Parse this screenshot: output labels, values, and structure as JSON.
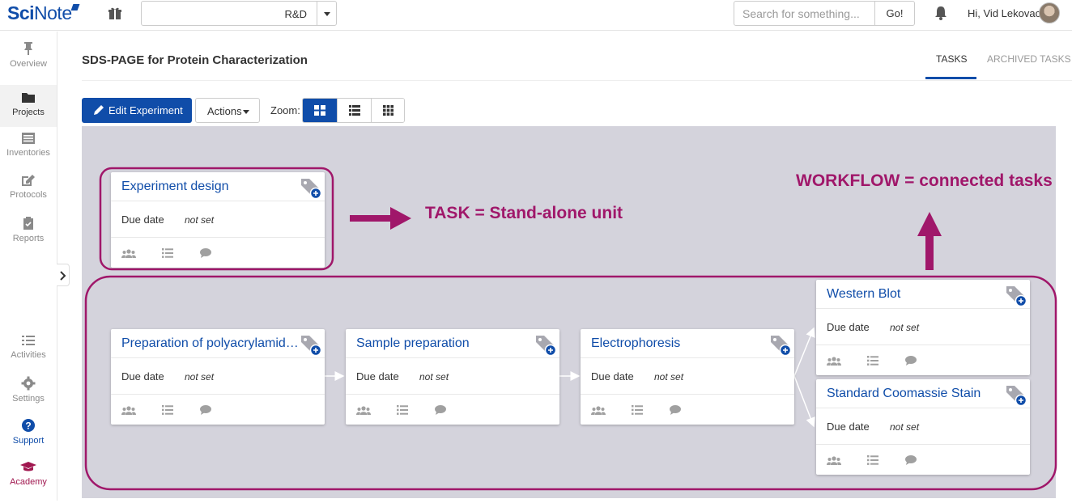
{
  "app": {
    "logo_bold": "Sci",
    "logo_rest": "Note"
  },
  "topbar": {
    "project_value": "R&D",
    "search_placeholder": "Search for something...",
    "go_label": "Go!",
    "greeting": "Hi, Vid Lekovac"
  },
  "sidebar": {
    "items": [
      {
        "label": "Overview",
        "icon": "pin-icon",
        "active": false
      },
      {
        "label": "Projects",
        "icon": "folder-icon",
        "active": true
      },
      {
        "label": "Inventories",
        "icon": "inventory-list-icon",
        "active": false
      },
      {
        "label": "Protocols",
        "icon": "edit-icon",
        "active": false
      },
      {
        "label": "Reports",
        "icon": "clipboard-icon",
        "active": false
      },
      {
        "label": "Activities",
        "icon": "list-icon",
        "active": false
      },
      {
        "label": "Settings",
        "icon": "gear-icon",
        "active": false
      },
      {
        "label": "Support",
        "icon": "question-icon",
        "active": false
      },
      {
        "label": "Academy",
        "icon": "graduation-cap-icon",
        "active": false
      }
    ]
  },
  "header": {
    "title": "SDS-PAGE for Protein Characterization",
    "tabs": [
      {
        "label": "TASKS",
        "active": true
      },
      {
        "label": "ARCHIVED TASKS",
        "active": false
      }
    ]
  },
  "toolbar": {
    "edit_label": "Edit Experiment",
    "actions_label": "Actions",
    "zoom_label": "Zoom:",
    "zoom_options": [
      "cards-view",
      "list-view",
      "grid-view"
    ],
    "zoom_active": "cards-view"
  },
  "tasks": [
    {
      "name": "Experiment design",
      "due_label": "Due date",
      "due_value": "not set"
    },
    {
      "name": "Preparation of polyacrylamide gel",
      "name_visible": "Preparation of polyacrylamid…",
      "due_label": "Due date",
      "due_value": "not set"
    },
    {
      "name": "Sample preparation",
      "due_label": "Due date",
      "due_value": "not set"
    },
    {
      "name": "Electrophoresis",
      "due_label": "Due date",
      "due_value": "not set"
    },
    {
      "name": "Western Blot",
      "due_label": "Due date",
      "due_value": "not set"
    },
    {
      "name": "Standard Coomassie Stain",
      "due_label": "Due date",
      "due_value": "not set"
    }
  ],
  "annotations": {
    "task": "TASK = Stand-alone unit",
    "workflow": "WORKFLOW = connected tasks",
    "color": "#a0176a"
  },
  "colors": {
    "brand": "#104da9",
    "canvas": "#d4d3dc",
    "annotation": "#a0176a"
  }
}
